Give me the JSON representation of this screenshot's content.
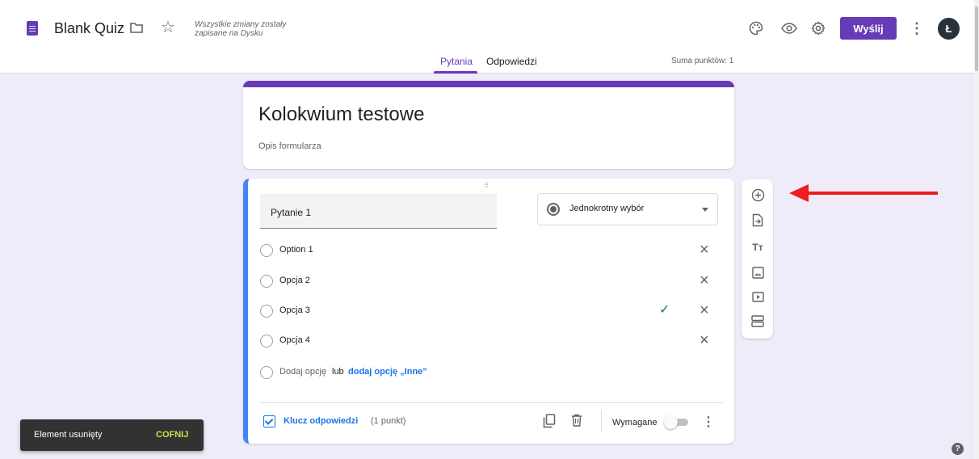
{
  "header": {
    "title": "Blank Quiz",
    "save_status": "Wszystkie zmiany zostały zapisane na Dysku",
    "send_label": "Wyślij",
    "avatar_initial": "Ł",
    "accent_color": "#673ab7"
  },
  "tabs": [
    {
      "label": "Pytania",
      "active": true
    },
    {
      "label": "Odpowiedzi",
      "active": false
    }
  ],
  "points_total": "Suma punktów: 1",
  "form": {
    "title": "Kolokwium testowe",
    "description_placeholder": "Opis formularza"
  },
  "question": {
    "title": "Pytanie 1",
    "type": "Jednokrotny wybór",
    "options": [
      {
        "label": "Option 1",
        "correct": false
      },
      {
        "label": "Opcja 2",
        "correct": false
      },
      {
        "label": "Opcja 3",
        "correct": true
      },
      {
        "label": "Opcja 4",
        "correct": false
      }
    ],
    "add_option": "Dodaj opcję",
    "add_option_or": "lub",
    "add_other": "dodaj opcję „Inne”",
    "answer_key": "Klucz odpowiedzi",
    "points": "(1 punkt)",
    "required_label": "Wymagane",
    "required": false
  },
  "side_toolbar": [
    "add-question-icon",
    "import-questions-icon",
    "add-title-icon",
    "add-image-icon",
    "add-video-icon",
    "add-section-icon"
  ],
  "snackbar": {
    "message": "Element usunięty",
    "action": "COFNIJ"
  }
}
